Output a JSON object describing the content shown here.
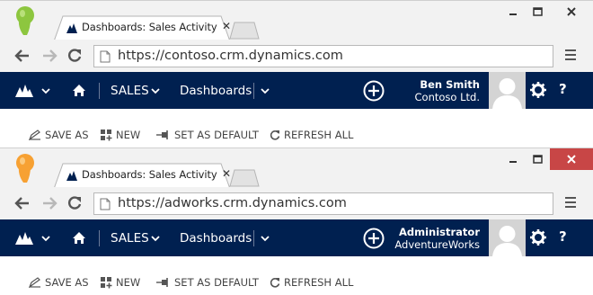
{
  "colors": {
    "crm_nav": "#002050",
    "close_active": "#c84646",
    "persona_green": "#8dc63f",
    "persona_orange": "#f7a133",
    "chrome": "#f2f2f2"
  },
  "windows": [
    {
      "persona_icon": "green-person-icon",
      "tab": {
        "title": "Dashboards: Sales Activity"
      },
      "url": "https://contoso.crm.dynamics.com",
      "nav": {
        "area": "SALES",
        "page": "Dashboards"
      },
      "user": {
        "name": "Ben Smith",
        "org": "Contoso Ltd."
      },
      "help": "?",
      "commands": [
        "SAVE AS",
        "NEW",
        "SET AS DEFAULT",
        "REFRESH ALL"
      ]
    },
    {
      "persona_icon": "orange-person-icon",
      "tab": {
        "title": "Dashboards: Sales Activity"
      },
      "url": "https://adworks.crm.dynamics.com",
      "nav": {
        "area": "SALES",
        "page": "Dashboards"
      },
      "user": {
        "name": "Administrator",
        "org": "AdventureWorks"
      },
      "help": "?",
      "commands": [
        "SAVE AS",
        "NEW",
        "SET AS DEFAULT",
        "REFRESH ALL"
      ]
    }
  ]
}
